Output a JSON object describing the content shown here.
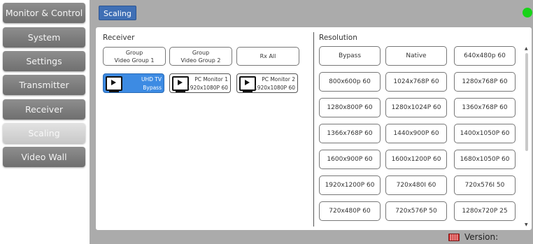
{
  "sidebar": {
    "items": [
      {
        "label": "Monitor & Control"
      },
      {
        "label": "System"
      },
      {
        "label": "Settings"
      },
      {
        "label": "Transmitter"
      },
      {
        "label": "Receiver"
      },
      {
        "label": "Scaling",
        "active": true
      },
      {
        "label": "Video Wall"
      }
    ]
  },
  "header": {
    "title": "Scaling",
    "status_color": "#19d319"
  },
  "receiver": {
    "title": "Receiver",
    "group_buttons": [
      {
        "line1": "Group",
        "line2": "Video Group 1"
      },
      {
        "line1": "Group",
        "line2": "Video Group 2"
      },
      {
        "line1": "Rx All",
        "line2": ""
      }
    ],
    "devices": [
      {
        "name": "UHD TV",
        "resolution": "Bypass",
        "selected": true,
        "icon": "monitor-icon"
      },
      {
        "name": "PC Monitor 1",
        "resolution": "1920x1080P 60",
        "selected": false,
        "icon": "monitor-icon"
      },
      {
        "name": "PC Monitor 2",
        "resolution": "1920x1080P 60",
        "selected": false,
        "icon": "monitor-icon"
      }
    ]
  },
  "resolution": {
    "title": "Resolution",
    "options": [
      "Bypass",
      "Native",
      "640x480p 60",
      "800x600p 60",
      "1024x768P 60",
      "1280x768P 60",
      "1280x800P 60",
      "1280x1024P 60",
      "1360x768P 60",
      "1366x768P 60",
      "1440x900P 60",
      "1400x1050P 60",
      "1600x900P 60",
      "1600x1200P 60",
      "1680x1050P 60",
      "1920x1200P 60",
      "720x480I 60",
      "720x576I 50",
      "720x480P 60",
      "720x576P 50",
      "1280x720P 25"
    ]
  },
  "footer": {
    "version_label": "Version:",
    "keyboard_icon": "keyboard-icon"
  },
  "colors": {
    "accent": "#3f6fb5",
    "selected": "#3d8be3",
    "status": "#19d319"
  }
}
